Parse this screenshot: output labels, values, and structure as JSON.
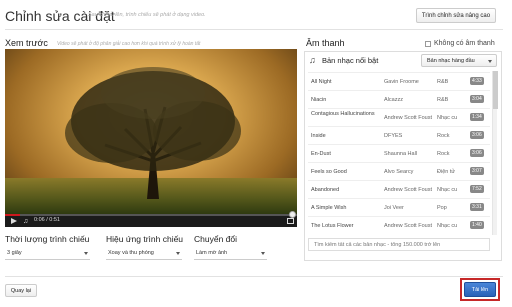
{
  "header": {
    "title": "Chỉnh sửa cài đặt",
    "note": "Sau khi tải lên, trình chiếu sẽ phát ở dạng video.",
    "advanced_button": "Trình chỉnh sửa nâng cao"
  },
  "preview": {
    "label": "Xem trước",
    "note": "Video sẽ phát ở độ phân giải cao hơn khi quá trình xử lý hoàn tất",
    "time": "0:06 / 0:51",
    "progress": 0.05
  },
  "options": {
    "duration": {
      "label": "Thời lượng trình chiếu",
      "value": "3 giây"
    },
    "effect": {
      "label": "Hiệu ứng trình chiếu",
      "value": "Xoay và thu phóng"
    },
    "transition": {
      "label": "Chuyển đổi",
      "value": "Làm mờ ảnh"
    }
  },
  "audio": {
    "label": "Âm thanh",
    "no_audio_label": "Không có âm thanh",
    "no_audio_checked": false,
    "featured_label": "Bản nhạc nổi bật",
    "sort_label": "Bản nhạc hàng đầu",
    "tracks": [
      {
        "name": "All Night",
        "artist": "Gavin Froome",
        "genre": "R&B",
        "duration": "4:33"
      },
      {
        "name": "Niacin",
        "artist": "Alcazzz",
        "genre": "R&B",
        "duration": "3:04"
      },
      {
        "name": "Contagious Hallucinations",
        "artist": "Andrew Scott Foust",
        "genre": "Nhạc cu",
        "duration": "1:34"
      },
      {
        "name": "Inside",
        "artist": "DFYES",
        "genre": "Rock",
        "duration": "3:06"
      },
      {
        "name": "En-Dust",
        "artist": "Shaunna Hall",
        "genre": "Rock",
        "duration": "3:06"
      },
      {
        "name": "Feels so Good",
        "artist": "Alvo Searcy",
        "genre": "Điện tử",
        "duration": "3:07"
      },
      {
        "name": "Abandoned",
        "artist": "Andrew Scott Foust",
        "genre": "Nhạc cu",
        "duration": "7:52"
      },
      {
        "name": "A Simple Wish",
        "artist": "Joi Veer",
        "genre": "Pop",
        "duration": "3:31"
      },
      {
        "name": "The Lotus Flower",
        "artist": "Andrew Scott Foust",
        "genre": "Nhạc cu",
        "duration": "1:40"
      }
    ],
    "search_placeholder": "Tìm kiếm tất cả các bản nhạc - tổng 150.000 trở lên"
  },
  "footer": {
    "back_button": "Quay lại",
    "upload_button": "Tải lên"
  },
  "colors": {
    "upload_blue": "#2a62b8",
    "highlight_red": "#c62828",
    "progress_red": "#cc181e"
  },
  "icons": [
    "music-note-icon",
    "play-icon",
    "volume-icon",
    "fullscreen-icon",
    "chevron-down-icon"
  ]
}
